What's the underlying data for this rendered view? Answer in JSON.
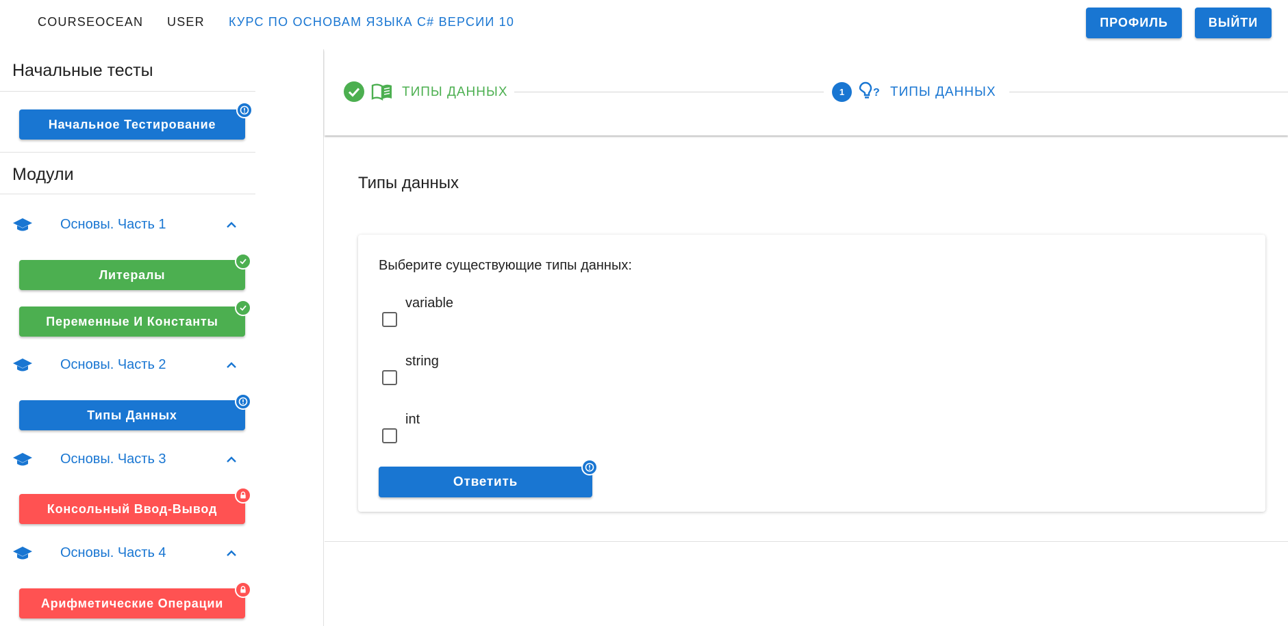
{
  "header": {
    "brand": "COURSEOCEAN",
    "user": "USER",
    "course": "КУРС ПО ОСНОВАМ ЯЗЫКА C# ВЕРСИИ 10",
    "profile_button": "ПРОФИЛЬ",
    "logout_button": "ВЫЙТИ"
  },
  "sidebar": {
    "initial_tests_title": "Начальные тесты",
    "initial_test_button": "Начальное Тестирование",
    "initial_test_status": "info",
    "modules_title": "Модули",
    "modules": [
      {
        "title": "Основы. Часть 1",
        "icon": "graduation-cap-icon",
        "expanded": true,
        "lessons": [
          {
            "label": "Литералы",
            "status": "completed"
          },
          {
            "label": "Переменные И Константы",
            "status": "completed"
          }
        ]
      },
      {
        "title": "Основы. Часть 2",
        "icon": "graduation-cap-icon",
        "expanded": true,
        "lessons": [
          {
            "label": "Типы Данных",
            "status": "current"
          }
        ]
      },
      {
        "title": "Основы. Часть 3",
        "icon": "graduation-cap-icon",
        "expanded": true,
        "lessons": [
          {
            "label": "Консольный Ввод-Вывод",
            "status": "locked"
          }
        ]
      },
      {
        "title": "Основы. Часть 4",
        "icon": "graduation-cap-icon",
        "expanded": true,
        "lessons": [
          {
            "label": "Арифметические Операции",
            "status": "locked"
          }
        ]
      }
    ]
  },
  "stepper": {
    "steps": [
      {
        "label": "ТИПЫ ДАННЫХ",
        "state": "complete",
        "icon": "book-open-icon"
      },
      {
        "number": "1",
        "label": "ТИПЫ ДАННЫХ",
        "state": "active",
        "icon": "lightbulb-question-icon"
      }
    ]
  },
  "content": {
    "title": "Типы данных",
    "question": "Выберите существующие типы данных:",
    "options": [
      {
        "label": "variable",
        "checked": false
      },
      {
        "label": "string",
        "checked": false
      },
      {
        "label": "int",
        "checked": false
      }
    ],
    "answer_button": "Ответить"
  },
  "colors": {
    "primary": "#1976d2",
    "success": "#4caf50",
    "locked": "#ff5252"
  }
}
